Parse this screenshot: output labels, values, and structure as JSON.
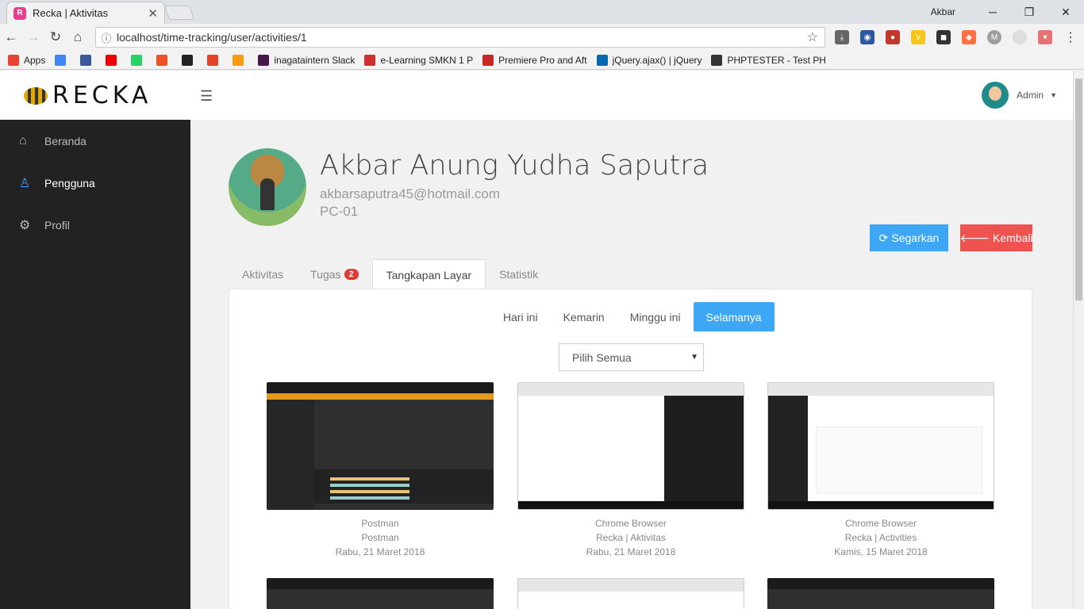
{
  "browser": {
    "tab_title": "Recka | Aktivitas",
    "tab_favicon": "recka-favicon",
    "user_name": "Akbar",
    "url": "localhost/time-tracking/user/activities/1",
    "bookmarks": [
      {
        "label": "Apps",
        "icon": "apps-icon",
        "color": "#ea4335"
      },
      {
        "label": "",
        "icon": "google-icon",
        "color": "#4285f4"
      },
      {
        "label": "",
        "icon": "facebook-icon",
        "color": "#3b5998"
      },
      {
        "label": "",
        "icon": "youtube-icon",
        "color": "#e00"
      },
      {
        "label": "",
        "icon": "whatsapp-icon",
        "color": "#25d366"
      },
      {
        "label": "",
        "icon": "microsoft-icon",
        "color": "#f25022"
      },
      {
        "label": "",
        "icon": "github-icon",
        "color": "#222"
      },
      {
        "label": "",
        "icon": "gitlab-icon",
        "color": "#e24329"
      },
      {
        "label": "",
        "icon": "pma-icon",
        "color": "#f89c0e"
      },
      {
        "label": "inagataintern Slack",
        "icon": "slack-icon",
        "color": "#4a154b"
      },
      {
        "label": "e-Learning SMKN 1 P",
        "icon": "elearning-icon",
        "color": "#d32f2f"
      },
      {
        "label": "Premiere Pro and Aft",
        "icon": "adobe-icon",
        "color": "#c62828"
      },
      {
        "label": "jQuery.ajax() | jQuery",
        "icon": "jquery-icon",
        "color": "#0769ad"
      },
      {
        "label": "PHPTESTER - Test PH",
        "icon": "php-icon",
        "color": "#333"
      }
    ]
  },
  "app": {
    "logo_text": "RECKA",
    "admin_label": "Admin",
    "sidebar": [
      {
        "label": "Beranda",
        "icon": "home-icon",
        "glyph": "⌂"
      },
      {
        "label": "Pengguna",
        "icon": "user-icon",
        "glyph": "♙"
      },
      {
        "label": "Profil",
        "icon": "gear-icon",
        "glyph": "⚙"
      }
    ]
  },
  "profile": {
    "name": "Akbar Anung Yudha Saputra",
    "email": "akbarsaputra45@hotmail.com",
    "pc": "PC-01"
  },
  "buttons": {
    "refresh": "Segarkan",
    "back": "Kembali"
  },
  "tabs": {
    "activities": "Aktivitas",
    "tasks": "Tugas",
    "tasks_badge": "2",
    "screenshots": "Tangkapan Layar",
    "stats": "Statistik"
  },
  "filters": {
    "today": "Hari ini",
    "yesterday": "Kemarin",
    "week": "Minggu ini",
    "all": "Selamanya"
  },
  "select_value": "Pilih Semua",
  "screenshots": [
    {
      "app": "Postman",
      "title": "Postman",
      "date": "Rabu, 21 Maret 2018",
      "style": "dark"
    },
    {
      "app": "Chrome Browser",
      "title": "Recka | Aktivitas",
      "date": "Rabu, 21 Maret 2018",
      "style": "split"
    },
    {
      "app": "Chrome Browser",
      "title": "Recka | Activities",
      "date": "Kamis, 15 Maret 2018",
      "style": "light"
    }
  ],
  "colors": {
    "primary": "#3ea7f5",
    "danger": "#ef5350",
    "sidebar": "#222222",
    "badge": "#e53935"
  }
}
